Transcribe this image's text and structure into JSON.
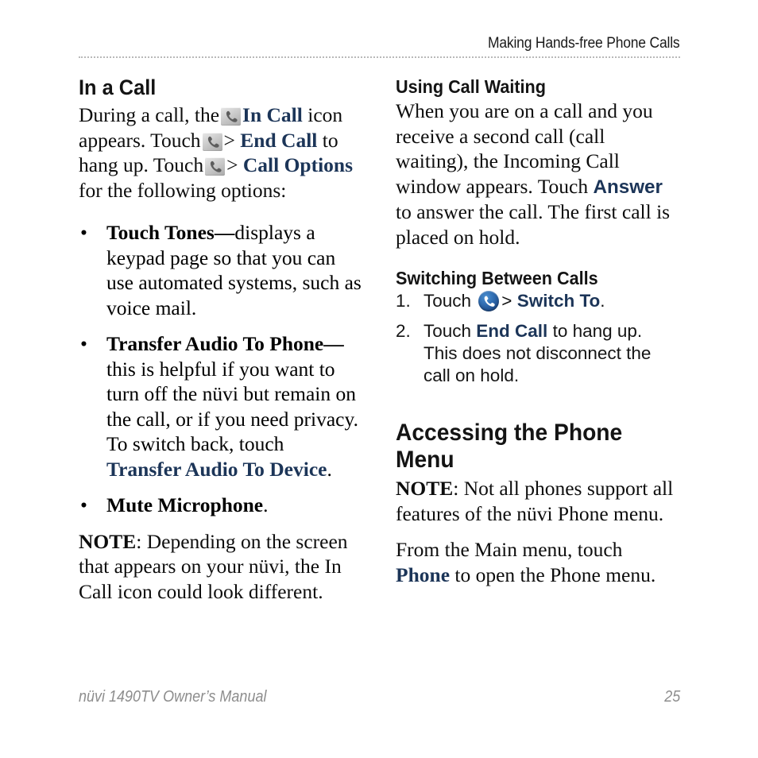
{
  "page": {
    "header_title": "Making Hands-free Phone Calls",
    "footer_left": "nüvi 1490TV Owner’s Manual",
    "footer_page_number": "25",
    "accent_blue": "#1c3558",
    "text_color": "#0d0d0d",
    "footer_color": "#8d8d8d",
    "rule_color": "#b9b9b9"
  },
  "left_column": {
    "heading": "In a Call",
    "intro": {
      "p1": "During a call, the",
      "icon1": "in-call-phone-icon",
      "label1": "In Call",
      "p2": "icon appears. Touch",
      "icon2": "in-call-phone-icon",
      "sep1": ">",
      "label2": "End Call",
      "p3": "to hang up. Touch",
      "icon3": "in-call-phone-icon",
      "sep2": ">",
      "label3": "Call Options",
      "p4": "for the following options:"
    },
    "bullets": [
      {
        "term": "Touch Tones",
        "dash": "—",
        "text": "displays a keypad page so that you can use automated systems, such as voice mail."
      },
      {
        "term": "Transfer Audio To Phone",
        "dash": "—",
        "text_before": "this is helpful if you want to turn off the nüvi but remain on the call, or if you need privacy. To switch back, touch ",
        "link": "Transfer Audio To Device",
        "text_after": "."
      },
      {
        "term": "Mute Microphone",
        "dash": "",
        "text": "."
      }
    ],
    "note": {
      "label": "NOTE",
      "text": ": Depending on the screen that appears on your nüvi, the In Call icon could look different."
    }
  },
  "right_column": {
    "call_waiting": {
      "heading": "Using Call Waiting",
      "text_before": "When you are on a call and you receive a second call (call waiting), the Incoming Call window appears. Touch ",
      "link": "Answer",
      "text_after": " to answer the call. The first call is placed on hold."
    },
    "switching": {
      "heading": "Switching Between Calls",
      "steps": [
        {
          "number": "1.",
          "text_before": "Touch ",
          "icon": "phone-circle-icon",
          "separator": ">",
          "link": "Switch To",
          "text_after": "."
        },
        {
          "number": "2.",
          "text_before": "Touch ",
          "link": "End Call",
          "text_after": " to hang up. This does not disconnect the call on hold."
        }
      ]
    },
    "accessing": {
      "heading_line1": "Accessing the Phone",
      "heading_line2": "Menu",
      "note_label": "NOTE",
      "note_text": ": Not all phones support all features of the nüvi Phone menu.",
      "para_before": "From the Main menu, touch ",
      "link": "Phone",
      "para_after": " to open the Phone menu."
    }
  }
}
